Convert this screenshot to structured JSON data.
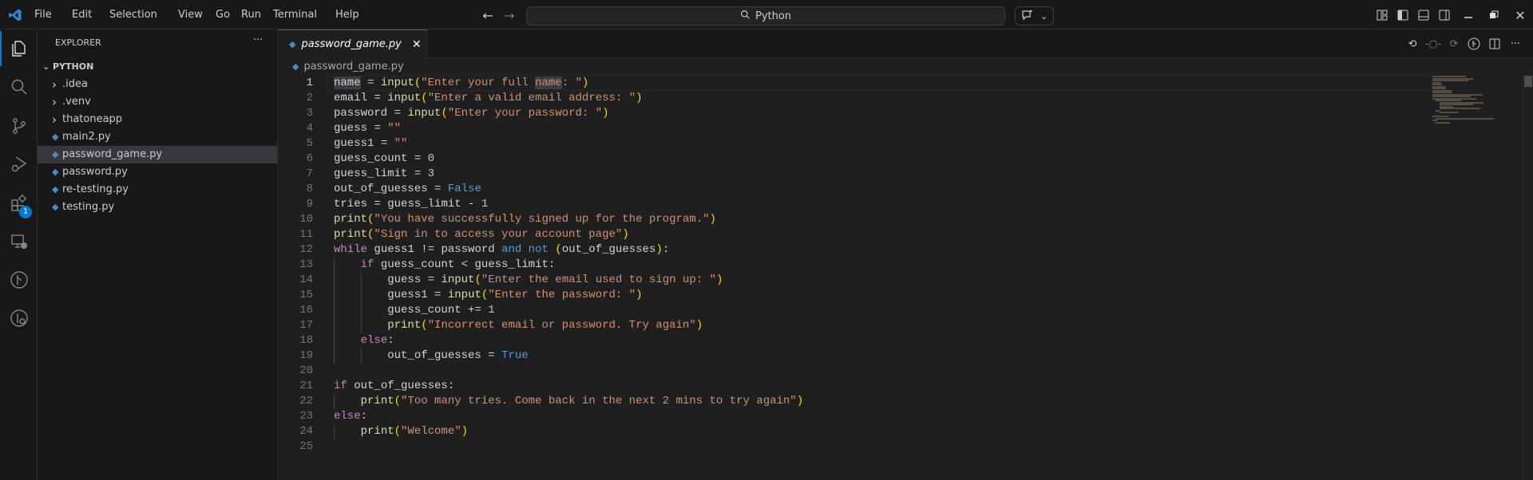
{
  "menu": [
    "File",
    "Edit",
    "Selection",
    "View",
    "Go",
    "Run",
    "Terminal",
    "Help"
  ],
  "search": {
    "value": "Python"
  },
  "sidebar": {
    "title": "EXPLORER",
    "more": "···",
    "folder": "PYTHON",
    "items": [
      {
        "label": ".idea",
        "type": "folder"
      },
      {
        "label": ".venv",
        "type": "folder"
      },
      {
        "label": "thatoneapp",
        "type": "folder"
      },
      {
        "label": "main2.py",
        "type": "file"
      },
      {
        "label": "password_game.py",
        "type": "file",
        "selected": true
      },
      {
        "label": "password.py",
        "type": "file"
      },
      {
        "label": "re-testing.py",
        "type": "file"
      },
      {
        "label": "testing.py",
        "type": "file"
      }
    ]
  },
  "activity": {
    "extensions_badge": "1"
  },
  "tab": {
    "label": "password_game.py"
  },
  "breadcrumb": "password_game.py",
  "editor": {
    "current_line": 1,
    "lines": [
      [
        [
          "id",
          "name",
          "hl"
        ],
        [
          "op",
          " = "
        ],
        [
          "fn",
          "input"
        ],
        [
          "p",
          "("
        ],
        [
          "str",
          "\"Enter your full "
        ],
        [
          "str",
          "name",
          "hl"
        ],
        [
          "str",
          ": \""
        ],
        [
          "p",
          ")"
        ]
      ],
      [
        [
          "id",
          "email"
        ],
        [
          "op",
          " = "
        ],
        [
          "fn",
          "input"
        ],
        [
          "p",
          "("
        ],
        [
          "str",
          "\"Enter a valid email address: \""
        ],
        [
          "p",
          ")"
        ]
      ],
      [
        [
          "id",
          "password"
        ],
        [
          "op",
          " = "
        ],
        [
          "fn",
          "input"
        ],
        [
          "p",
          "("
        ],
        [
          "str",
          "\"Enter your password: \""
        ],
        [
          "p",
          ")"
        ]
      ],
      [
        [
          "id",
          "guess"
        ],
        [
          "op",
          " = "
        ],
        [
          "str",
          "\"\""
        ]
      ],
      [
        [
          "id",
          "guess1"
        ],
        [
          "op",
          " = "
        ],
        [
          "str",
          "\"\""
        ]
      ],
      [
        [
          "id",
          "guess_count"
        ],
        [
          "op",
          " = "
        ],
        [
          "num",
          "0"
        ]
      ],
      [
        [
          "id",
          "guess_limit"
        ],
        [
          "op",
          " = "
        ],
        [
          "num",
          "3"
        ]
      ],
      [
        [
          "id",
          "out_of_guesses"
        ],
        [
          "op",
          " = "
        ],
        [
          "const",
          "False"
        ]
      ],
      [
        [
          "id",
          "tries"
        ],
        [
          "op",
          " = "
        ],
        [
          "id",
          "guess_limit"
        ],
        [
          "op",
          " - "
        ],
        [
          "num",
          "1"
        ]
      ],
      [
        [
          "fn",
          "print"
        ],
        [
          "p",
          "("
        ],
        [
          "str",
          "\"You have successfully signed up for the program.\""
        ],
        [
          "p",
          ")"
        ]
      ],
      [
        [
          "fn",
          "print"
        ],
        [
          "p",
          "("
        ],
        [
          "str",
          "\"Sign in to access your account page\""
        ],
        [
          "p",
          ")"
        ]
      ],
      [
        [
          "kw",
          "while"
        ],
        [
          "id",
          " guess1 "
        ],
        [
          "op",
          "!= "
        ],
        [
          "id",
          "password "
        ],
        [
          "const",
          "and not "
        ],
        [
          "p",
          "("
        ],
        [
          "id",
          "out_of_guesses"
        ],
        [
          "p",
          ")"
        ],
        [
          "op",
          ":"
        ]
      ],
      [
        [
          "op",
          "    "
        ],
        [
          "kw",
          "if"
        ],
        [
          "id",
          " guess_count "
        ],
        [
          "op",
          "< "
        ],
        [
          "id",
          "guess_limit"
        ],
        [
          "op",
          ":"
        ]
      ],
      [
        [
          "op",
          "        "
        ],
        [
          "id",
          "guess"
        ],
        [
          "op",
          " = "
        ],
        [
          "fn",
          "input"
        ],
        [
          "p",
          "("
        ],
        [
          "str",
          "\"Enter the email used to sign up: \""
        ],
        [
          "p",
          ")"
        ]
      ],
      [
        [
          "op",
          "        "
        ],
        [
          "id",
          "guess1"
        ],
        [
          "op",
          " = "
        ],
        [
          "fn",
          "input"
        ],
        [
          "p",
          "("
        ],
        [
          "str",
          "\"Enter the password: \""
        ],
        [
          "p",
          ")"
        ]
      ],
      [
        [
          "op",
          "        "
        ],
        [
          "id",
          "guess_count"
        ],
        [
          "op",
          " += "
        ],
        [
          "num",
          "1"
        ]
      ],
      [
        [
          "op",
          "        "
        ],
        [
          "fn",
          "print"
        ],
        [
          "p",
          "("
        ],
        [
          "str",
          "\"Incorrect email or password. Try again\""
        ],
        [
          "p",
          ")"
        ]
      ],
      [
        [
          "op",
          "    "
        ],
        [
          "kw",
          "else"
        ],
        [
          "op",
          ":"
        ]
      ],
      [
        [
          "op",
          "        "
        ],
        [
          "id",
          "out_of_guesses"
        ],
        [
          "op",
          " = "
        ],
        [
          "const",
          "True"
        ]
      ],
      [],
      [
        [
          "kw",
          "if"
        ],
        [
          "id",
          " out_of_guesses"
        ],
        [
          "op",
          ":"
        ]
      ],
      [
        [
          "op",
          "    "
        ],
        [
          "fn",
          "print"
        ],
        [
          "p",
          "("
        ],
        [
          "str",
          "\"Too many tries. Come back in the next 2 mins to try again\""
        ],
        [
          "p",
          ")"
        ]
      ],
      [
        [
          "kw",
          "else"
        ],
        [
          "op",
          ":"
        ]
      ],
      [
        [
          "op",
          "    "
        ],
        [
          "fn",
          "print"
        ],
        [
          "p",
          "("
        ],
        [
          "str",
          "\"Welcome\""
        ],
        [
          "p",
          ")"
        ]
      ],
      []
    ],
    "guides": [
      [],
      [],
      [],
      [],
      [],
      [],
      [],
      [],
      [],
      [],
      [],
      [],
      [
        1
      ],
      [
        1,
        2
      ],
      [
        1,
        2
      ],
      [
        1,
        2
      ],
      [
        1,
        2
      ],
      [
        1
      ],
      [
        1,
        2
      ],
      [],
      [],
      [
        1
      ],
      [],
      [
        1
      ],
      []
    ]
  },
  "colors": {
    "accent": "#0078d4",
    "badge": "#0078d4"
  }
}
